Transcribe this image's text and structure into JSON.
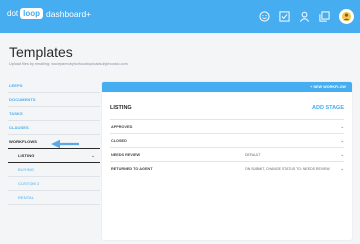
{
  "brand": {
    "prefix": "dot",
    "box": "loop",
    "suffix": "dashboard+"
  },
  "header": {
    "title": "Templates",
    "subtitle": "Upload files by emailing: wocepareobyfoxfocobuploadsubjchooslo.com"
  },
  "sidebar": {
    "items": [
      {
        "label": "LEEPS"
      },
      {
        "label": "DOCUMENTS"
      },
      {
        "label": "TASKS"
      },
      {
        "label": "CLAUSES"
      },
      {
        "label": "WORKFLOWS"
      }
    ],
    "subitems": [
      {
        "label": "LISTING"
      },
      {
        "label": "BUYING"
      },
      {
        "label": "CUSTOM 2"
      },
      {
        "label": "RENTAL"
      }
    ]
  },
  "panel": {
    "new_workflow_label": "+ NEW WORKFLOW",
    "title": "LISTING",
    "add_stage_label": "ADD STAGE",
    "stages": [
      {
        "name": "APPROVED",
        "info": ""
      },
      {
        "name": "CLOSED",
        "info": ""
      },
      {
        "name": "NEEDS REVIEW",
        "info": "DEFAULT"
      },
      {
        "name": "RETURNED TO AGENT",
        "info": "ON SUBMIT, CHANGE STATUS TO: NEEDS REVIEW"
      }
    ]
  },
  "colors": {
    "accent": "#45adf0",
    "background": "#f3f5f7"
  }
}
